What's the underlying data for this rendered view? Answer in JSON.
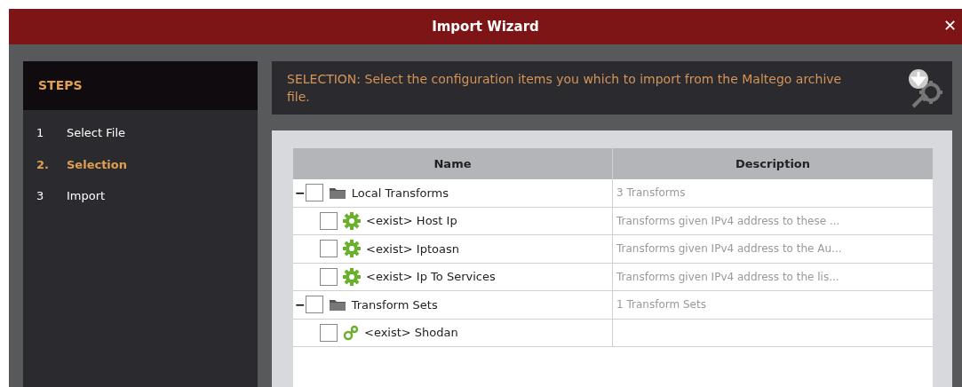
{
  "window": {
    "title": "Import Wizard",
    "close": "✕"
  },
  "steps": {
    "title": "STEPS",
    "items": [
      {
        "number": "1",
        "label": "Select File",
        "selected": false
      },
      {
        "number": "2.",
        "label": "Selection",
        "selected": true
      },
      {
        "number": "3",
        "label": "Import",
        "selected": false
      }
    ]
  },
  "banner": {
    "text": "SELECTION: Select the configuration items you which to import from the Maltego archive file."
  },
  "table": {
    "columns": [
      "Name",
      "Description"
    ],
    "rows": [
      {
        "kind": "folder",
        "name": "Local Transforms",
        "description": "3 Transforms",
        "checked": false,
        "toggle": "−",
        "children": [
          {
            "kind": "transform",
            "name": "<exist> Host Ip",
            "description": "Transforms given IPv4 address to these ...",
            "checked": false
          },
          {
            "kind": "transform",
            "name": "<exist> Iptoasn",
            "description": "Transforms given IPv4 address to the Au...",
            "checked": false
          },
          {
            "kind": "transform",
            "name": "<exist> Ip To Services",
            "description": "Transforms given IPv4 address to the lis...",
            "checked": false
          }
        ]
      },
      {
        "kind": "folder",
        "name": "Transform Sets",
        "description": "1 Transform Sets",
        "checked": false,
        "toggle": "−",
        "children": [
          {
            "kind": "set",
            "name": "<exist> Shodan",
            "checked": false
          }
        ]
      }
    ]
  }
}
